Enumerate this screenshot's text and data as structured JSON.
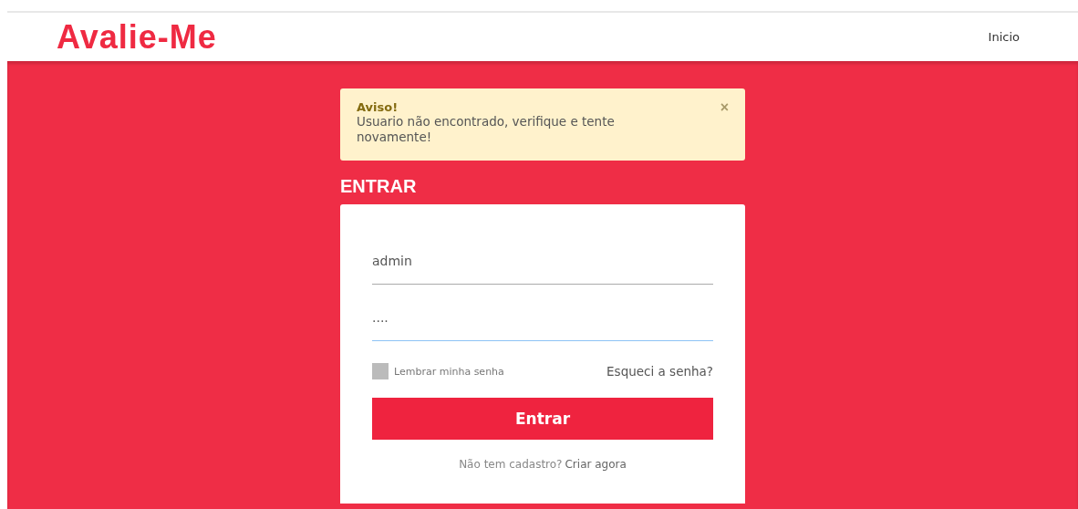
{
  "header": {
    "logo": "Avalie-Me",
    "nav": [
      {
        "label": "Inicio"
      }
    ]
  },
  "alert": {
    "title": "Aviso!",
    "message": "Usuario não encontrado, verifique e tente novamente!",
    "close": "×"
  },
  "login": {
    "heading": "ENTRAR",
    "fields": [
      {
        "value": "admin",
        "focused": false
      },
      {
        "value": "....",
        "focused": true
      }
    ],
    "remember": {
      "label": "Lembrar minha senha",
      "checked": false
    },
    "forgot": "Esqueci a senha?",
    "submit": "Entrar",
    "signup_prompt": "Não tem cadastro?",
    "signup_link": "Criar agora"
  }
}
